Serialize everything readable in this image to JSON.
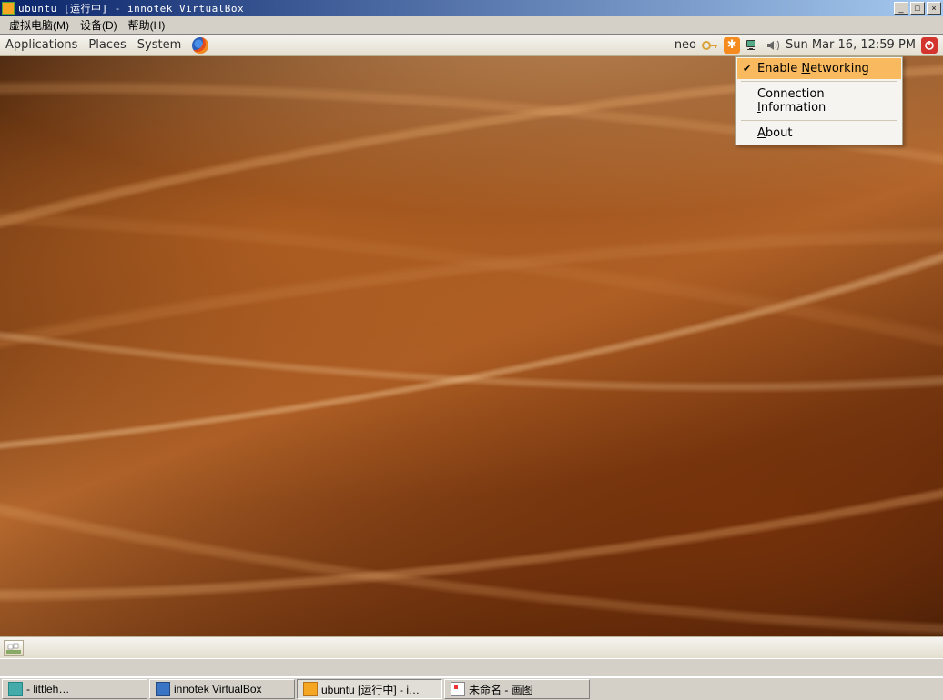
{
  "vbox": {
    "title": "ubuntu [运行中] - innotek VirtualBox",
    "menu": {
      "machine": "虚拟电脑(M)",
      "devices": "设备(D)",
      "help": "帮助(H)"
    }
  },
  "gnome": {
    "menus": {
      "applications": "Applications",
      "places": "Places",
      "system": "System"
    },
    "user": "neo",
    "clock": "Sun Mar 16, 12:59 PM"
  },
  "nm_menu": {
    "enable_networking": "Enable Networking",
    "enable_networking_checked": true,
    "connection_info": "Connection Information",
    "about": "About"
  },
  "host_taskbar": {
    "items": [
      {
        "label": "- littleh…"
      },
      {
        "label": "innotek VirtualBox"
      },
      {
        "label": "ubuntu [运行中] - i…"
      },
      {
        "label": "未命名 - 画图"
      }
    ]
  }
}
